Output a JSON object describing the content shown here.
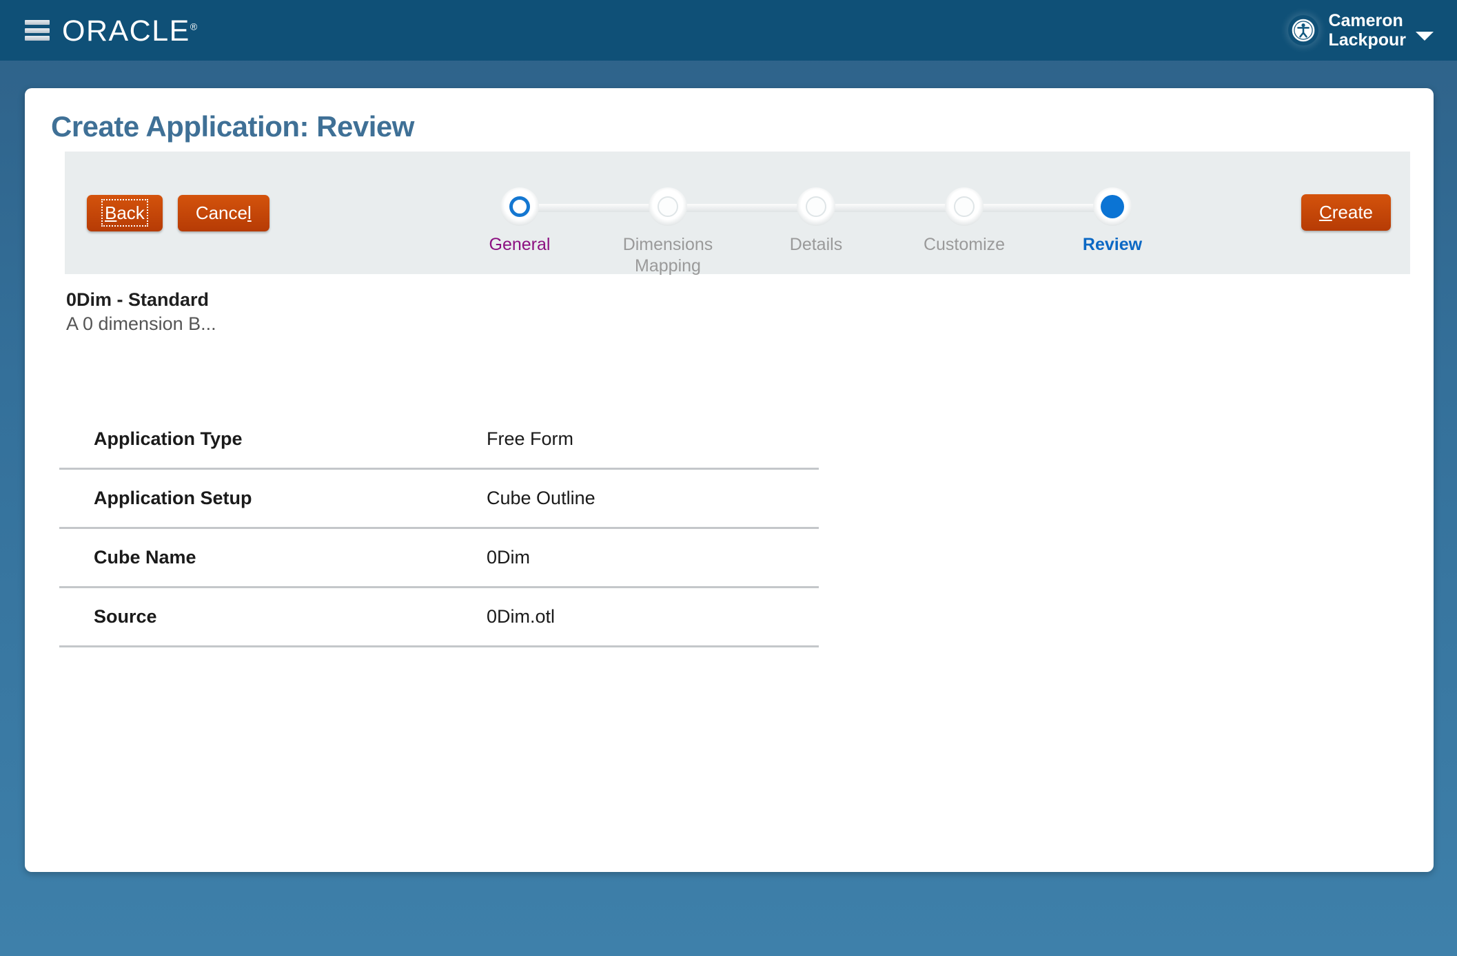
{
  "header": {
    "menu_icon": "hamburger-menu-icon",
    "logo_text": "ORACLE",
    "logo_registered": "®",
    "user_name_line1": "Cameron",
    "user_name_line2": "Lackpour",
    "avatar_icon": "accessibility-person-icon",
    "caret_icon": "chevron-down-icon",
    "background_color": "#0f5077"
  },
  "page": {
    "title": "Create Application: Review",
    "title_color": "#3f7096",
    "background_color": "#3a7aa4"
  },
  "toolbar": {
    "back_label": "Back",
    "back_accesskey": "B",
    "cancel_label": "Cance",
    "cancel_accesskey": "l",
    "create_accesskey": "C",
    "create_label": "reate",
    "button_color": "#c04508"
  },
  "train": {
    "background_color": "#e9edee",
    "steps": [
      {
        "label": "General",
        "state": "visited",
        "color": "#8c1081"
      },
      {
        "label": "Dimensions Mapping",
        "state": "upcoming",
        "color": "#9a9a9a"
      },
      {
        "label": "Details",
        "state": "upcoming",
        "color": "#9a9a9a"
      },
      {
        "label": "Customize",
        "state": "upcoming",
        "color": "#9a9a9a"
      },
      {
        "label": "Review",
        "state": "active",
        "color": "#0b68c4"
      }
    ]
  },
  "summary": {
    "title": "0Dim - Standard",
    "description": "A 0 dimension B..."
  },
  "details": {
    "rows": [
      {
        "label": "Application Type",
        "value": "Free Form"
      },
      {
        "label": "Application Setup",
        "value": "Cube Outline"
      },
      {
        "label": "Cube Name",
        "value": "0Dim"
      },
      {
        "label": "Source",
        "value": "0Dim.otl"
      }
    ]
  }
}
